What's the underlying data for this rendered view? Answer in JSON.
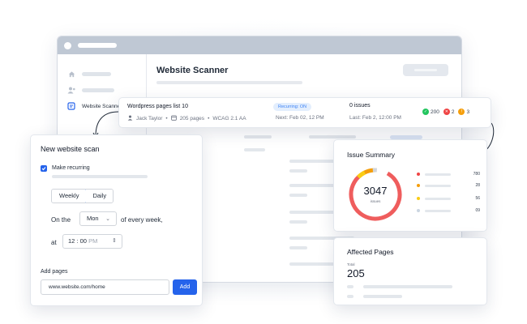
{
  "colors": {
    "accent": "#2563eb",
    "badge_bg": "#e3eefd",
    "donut_red": "#ef5d5d",
    "donut_orange": "#f59e0b",
    "donut_yellow": "#facc15",
    "success": "#22c55e",
    "error": "#ef4444",
    "warning": "#f59e0b"
  },
  "window": {
    "page_title": "Website Scanner",
    "sidebar": {
      "items": [
        {
          "icon": "home-icon",
          "label": ""
        },
        {
          "icon": "users-icon",
          "label": ""
        },
        {
          "icon": "scanner-icon",
          "label": "Website Scanner"
        }
      ]
    }
  },
  "scan": {
    "name": "Wordpress pages list 10",
    "owner": "Jack Taylor",
    "pages": "205 pages",
    "standard": "WCAG 2.1 AA",
    "badge": "Recurring: ON",
    "next_run": "Next: Feb 02, 12 PM",
    "issues": "0 issues",
    "last_run": "Last: Feb 2, 12:00 PM",
    "counts": {
      "passed": "200",
      "failed": "2",
      "warnings": "3"
    }
  },
  "new_scan": {
    "title": "New website scan",
    "recurring_label": "Make recurring",
    "freq_weekly": "Weekly",
    "freq_daily": "Daily",
    "on_the": "On the",
    "day_value": "Mon",
    "every_week": "of every week,",
    "at": "at",
    "time_hour": "12",
    "time_minute": "00",
    "time_ampm": "PM",
    "add_pages_label": "Add pages",
    "url_value": "www.website.com/home",
    "add_button": "Add"
  },
  "summary": {
    "title": "Issue Summary",
    "total": "3047",
    "total_label": "issues",
    "legend": [
      {
        "color": "#ef4444",
        "value": "780"
      },
      {
        "color": "#f59e0b",
        "value": "28"
      },
      {
        "color": "#facc15",
        "value": "56"
      },
      {
        "color": "#cbd5e1",
        "value": "09"
      }
    ]
  },
  "affected": {
    "title": "Affected Pages",
    "total_label": "Total",
    "total": "205"
  }
}
